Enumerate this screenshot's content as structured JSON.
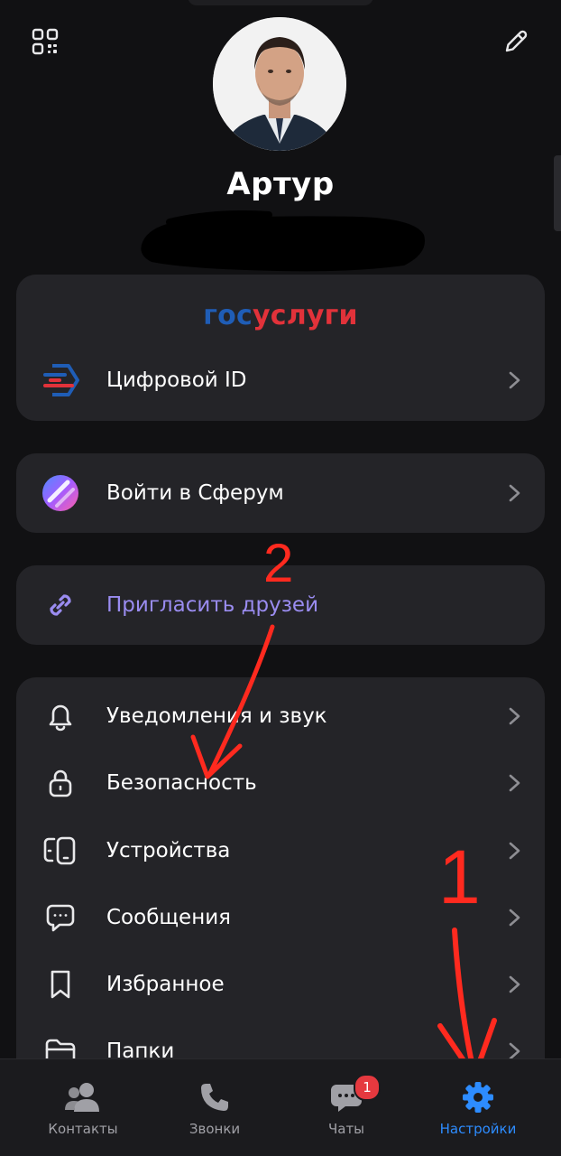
{
  "profile": {
    "name": "Артур"
  },
  "gosuslugi": {
    "logo_part1": "гос",
    "logo_part2": "услуги",
    "digital_id_label": "Цифровой ID"
  },
  "sferum": {
    "label": "Войти в Сферум"
  },
  "invite": {
    "label": "Пригласить друзей"
  },
  "settings": {
    "items": [
      {
        "label": "Уведомления и звук",
        "icon": "bell-icon"
      },
      {
        "label": "Безопасность",
        "icon": "lock-icon"
      },
      {
        "label": "Устройства",
        "icon": "devices-icon"
      },
      {
        "label": "Сообщения",
        "icon": "message-icon"
      },
      {
        "label": "Избранное",
        "icon": "bookmark-icon"
      },
      {
        "label": "Папки",
        "icon": "folder-icon"
      }
    ]
  },
  "annotations": {
    "mark1": "1",
    "mark2": "2"
  },
  "tabbar": {
    "tabs": [
      {
        "label": "Контакты",
        "icon": "contacts-icon"
      },
      {
        "label": "Звонки",
        "icon": "phone-icon"
      },
      {
        "label": "Чаты",
        "icon": "chat-icon",
        "badge": "1"
      },
      {
        "label": "Настройки",
        "icon": "gear-icon",
        "active": true
      }
    ]
  },
  "colors": {
    "background": "#111113",
    "card": "#242428",
    "accent": "#2d8cff",
    "invite_text": "#9a8cf0",
    "annotation": "#ff2a1f",
    "badge": "#e5393f"
  }
}
